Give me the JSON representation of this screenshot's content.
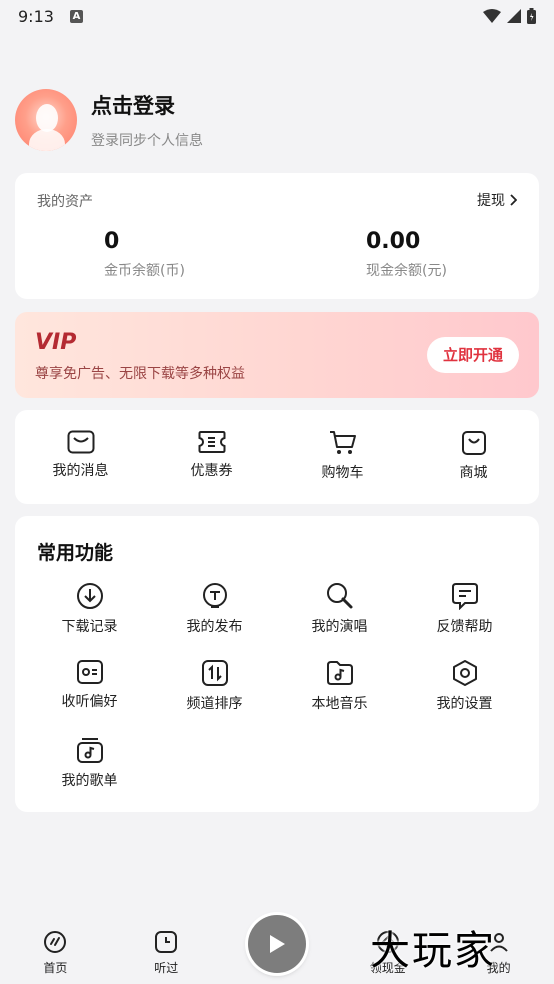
{
  "status_bar": {
    "time": "9:13",
    "notif_letter": "A"
  },
  "profile": {
    "title": "点击登录",
    "subtitle": "登录同步个人信息"
  },
  "assets": {
    "label": "我的资产",
    "withdraw": "提现",
    "coins": {
      "value": "0",
      "caption": "金币余额(币)"
    },
    "cash": {
      "value": "0.00",
      "caption": "现金余额(元)"
    }
  },
  "vip": {
    "title": "VIP",
    "description": "尊享免广告、无限下载等多种权益",
    "button": "立即开通"
  },
  "quick": [
    {
      "label": "我的消息",
      "icon": "message-icon"
    },
    {
      "label": "优惠券",
      "icon": "coupon-icon"
    },
    {
      "label": "购物车",
      "icon": "cart-icon"
    },
    {
      "label": "商城",
      "icon": "shop-bag-icon"
    }
  ],
  "functions": {
    "title": "常用功能",
    "items": [
      {
        "label": "下载记录",
        "icon": "download-icon"
      },
      {
        "label": "我的发布",
        "icon": "publish-icon"
      },
      {
        "label": "我的演唱",
        "icon": "sing-icon"
      },
      {
        "label": "反馈帮助",
        "icon": "feedback-icon"
      },
      {
        "label": "收听偏好",
        "icon": "preference-icon"
      },
      {
        "label": "频道排序",
        "icon": "sort-icon"
      },
      {
        "label": "本地音乐",
        "icon": "local-music-icon"
      },
      {
        "label": "我的设置",
        "icon": "settings-icon"
      },
      {
        "label": "我的歌单",
        "icon": "playlist-icon"
      }
    ]
  },
  "bottom_nav": {
    "tabs": [
      {
        "label": "首页",
        "icon": "home-icon"
      },
      {
        "label": "听过",
        "icon": "history-icon"
      },
      {
        "label": "领现金",
        "icon": "cash-icon"
      },
      {
        "label": "我的",
        "icon": "me-icon"
      }
    ]
  },
  "watermark": "大玩家"
}
